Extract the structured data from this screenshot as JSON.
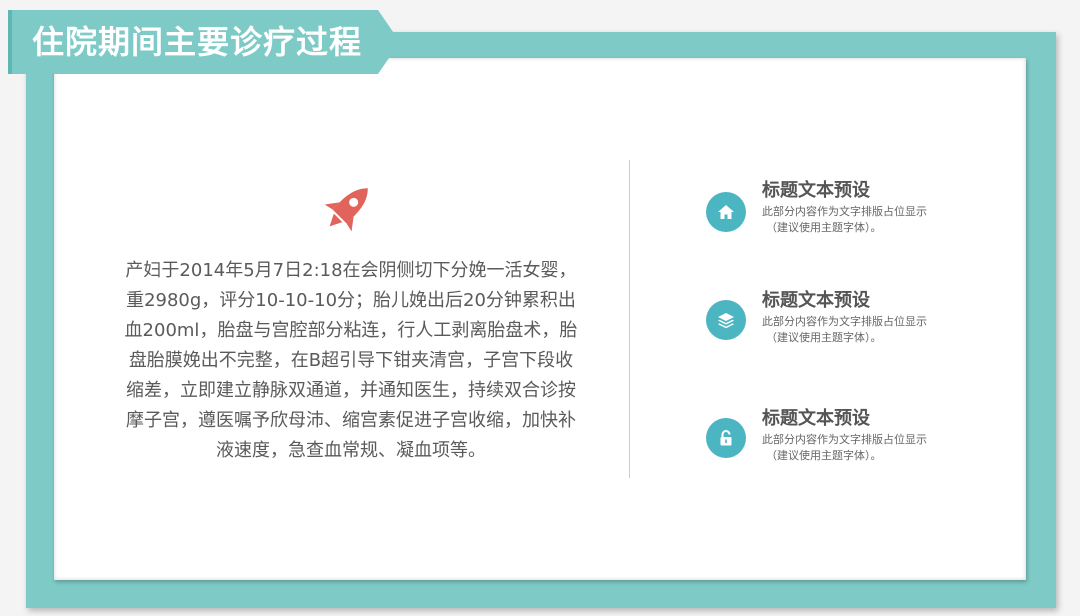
{
  "title": "住院期间主要诊疗过程",
  "body": {
    "lines": [
      "产妇于2014年5月7日2:18在会阴侧切下分娩一活女婴，",
      "重2980g，评分10-10-10分；胎儿娩出后20分钟累积出",
      "血200ml，胎盘与宫腔部分粘连，行人工剥离胎盘术，胎",
      "盘胎膜娩出不完整，在B超引导下钳夹清宫，子宫下段收",
      "缩差，立即建立静脉双通道，并通知医生，持续双合诊按",
      "摩子宫，遵医嘱予欣母沛、缩宫素促进子宫收缩，加快补",
      "液速度，急查血常规、凝血项等。"
    ]
  },
  "items": [
    {
      "icon": "home-icon",
      "heading": "标题文本预设",
      "desc1": "此部分内容作为文字排版占位显示",
      "desc2": "（建议使用主题字体）。"
    },
    {
      "icon": "layers-icon",
      "heading": "标题文本预设",
      "desc1": "此部分内容作为文字排版占位显示",
      "desc2": "（建议使用主题字体）。"
    },
    {
      "icon": "lock-icon",
      "heading": "标题文本预设",
      "desc1": "此部分内容作为文字排版占位显示",
      "desc2": "（建议使用主题字体）。"
    }
  ],
  "colors": {
    "frame": "#7ecac7",
    "accent_circle": "#4bb5c1",
    "rocket": "#e0645c",
    "text": "#5a5a5a"
  }
}
